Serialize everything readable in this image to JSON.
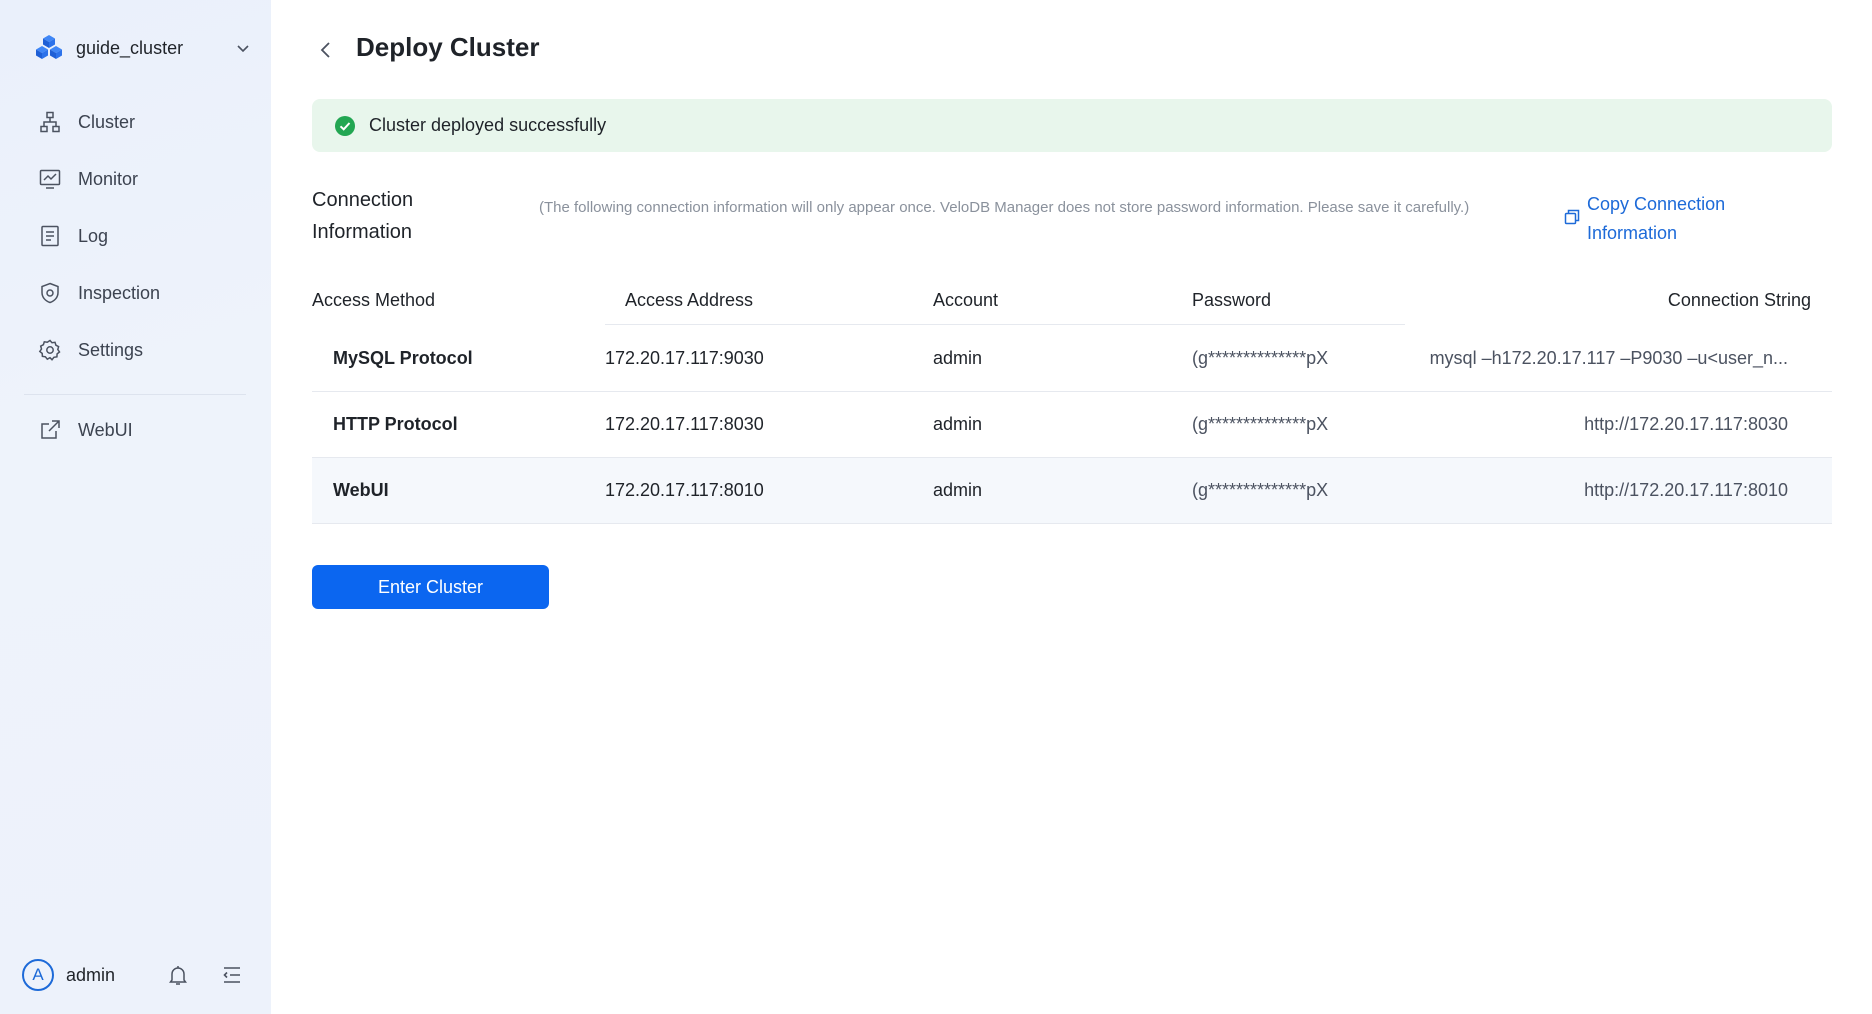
{
  "sidebar": {
    "cluster_name": "guide_cluster",
    "items": [
      {
        "label": "Cluster",
        "icon": "cluster-icon"
      },
      {
        "label": "Monitor",
        "icon": "monitor-icon"
      },
      {
        "label": "Log",
        "icon": "log-icon"
      },
      {
        "label": "Inspection",
        "icon": "shield-icon"
      },
      {
        "label": "Settings",
        "icon": "gear-icon"
      }
    ],
    "webui": {
      "label": "WebUI",
      "icon": "external-link-icon"
    },
    "footer": {
      "avatar_letter": "A",
      "user": "admin"
    }
  },
  "header": {
    "title": "Deploy Cluster"
  },
  "alert": {
    "message": "Cluster deployed successfully",
    "color": "#e8f6ec"
  },
  "connection": {
    "title": "Connection Information",
    "note": "(The following connection information will only appear once. VeloDB Manager does not store password information. Please save it carefully.)",
    "copy_label": "Copy Connection Information"
  },
  "table": {
    "headers": [
      "Access Method",
      "Access Address",
      "Account",
      "Password",
      "Connection String"
    ],
    "rows": [
      {
        "method": "MySQL Protocol",
        "address": "172.20.17.117:9030",
        "account": "admin",
        "password": "(g**************pX",
        "conn": "mysql –h172.20.17.117 –P9030 –u<user_n..."
      },
      {
        "method": "HTTP Protocol",
        "address": "172.20.17.117:8030",
        "account": "admin",
        "password": "(g**************pX",
        "conn": "http://172.20.17.117:8030"
      },
      {
        "method": "WebUI",
        "address": "172.20.17.117:8010",
        "account": "admin",
        "password": "(g**************pX",
        "conn": "http://172.20.17.117:8010"
      }
    ]
  },
  "actions": {
    "enter_label": "Enter Cluster"
  },
  "colors": {
    "accent": "#0b66f0",
    "success": "#22a652"
  }
}
